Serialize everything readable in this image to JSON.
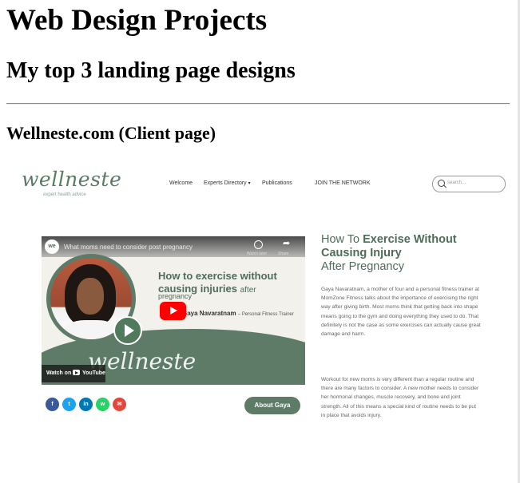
{
  "page": {
    "title": "Web Design Projects",
    "subtitle": "My top 3 landing page designs",
    "project_heading": "Wellneste.com (Client page)"
  },
  "site": {
    "logo_text": "wellneste",
    "logo_tagline": "expert health advice",
    "nav": {
      "welcome": "Welcome",
      "experts": "Experts Directory",
      "caret": "▾",
      "publications": "Publications",
      "join": "JOIN THE NETWORK"
    },
    "search_placeholder": "search..."
  },
  "video": {
    "channel_badge": "we",
    "title": "What moms need to consider post pregnancy",
    "watch_later": "Watch later",
    "share": "Share",
    "heading": "How to exercise without causing injuries",
    "heading_tail": "after",
    "subheading": "pregnancy",
    "presenter": "Gaya Navaratnam",
    "presenter_role": "– Personal Fitness Trainer",
    "script_text": "wellneste",
    "watch_on": "Watch on",
    "youtube": "YouTube"
  },
  "social": [
    {
      "icon": "facebook-icon",
      "glyph": "f",
      "color": "#3b5998"
    },
    {
      "icon": "twitter-icon",
      "glyph": "t",
      "color": "#1da1f2"
    },
    {
      "icon": "linkedin-icon",
      "glyph": "in",
      "color": "#0077b5"
    },
    {
      "icon": "whatsapp-icon",
      "glyph": "w",
      "color": "#25d366"
    },
    {
      "icon": "email-icon",
      "glyph": "✉",
      "color": "#e2483d"
    }
  ],
  "about_button": "About Gaya",
  "article": {
    "title_prefix": "How To ",
    "title_bold": "Exercise Without Causing Injury",
    "title_suffix": "After Pregnancy",
    "paragraph1": "Gaya Navaratnam, a mother of four and a personal fitness trainer at MomZone Fitness talks about the importance of exercising the right way after giving birth.  Most moms think that getting back into shape means going to the gym and doing everything they used to do.  That definitely is not the case as some exercises can actually cause great damage and harm.",
    "paragraph2": "Workout for new moms is very different than a regular routine and there are many factors to consider. A new mother needs to consider her hormonal changes, muscle recovery, and bone and joint strength.  All of this means a special kind of routine needs to be put in place that avoids injury."
  },
  "colors": {
    "brand_green": "#5d7b67",
    "youtube_red": "#ff0000"
  }
}
